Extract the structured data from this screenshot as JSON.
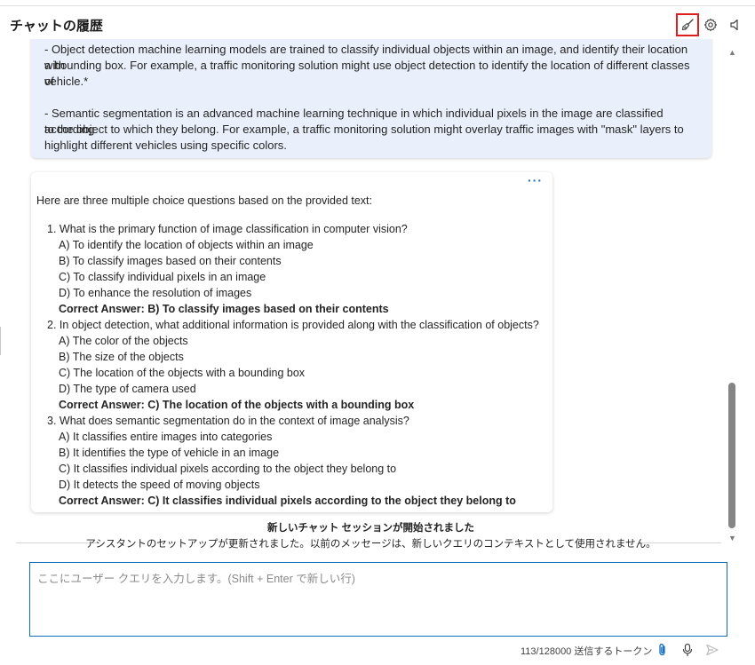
{
  "header": {
    "title": "チャットの履歴",
    "icons": [
      "broom-clear-icon",
      "gear-icon",
      "speaker-icon"
    ]
  },
  "user_message": {
    "lines": [
      "- Object detection machine learning models are trained to classify individual objects within an image, and identify their location with",
      "a bounding box. For example, a traffic monitoring solution might use object detection to identify the location of different classes of",
      "vehicle.*",
      "- Semantic segmentation is an advanced machine learning technique in which individual pixels in the image are classified according",
      "to the object to which they belong. For example, a traffic monitoring solution might overlay traffic images with \"mask\" layers to",
      "highlight different vehicles using specific colors."
    ]
  },
  "assistant_message": {
    "more_label": "···",
    "intro": "Here are three multiple choice questions based on the provided text:",
    "questions": [
      {
        "question": "1. What is the primary function of image classification in computer vision?",
        "options": [
          "A) To identify the location of objects within an image",
          "B) To classify images based on their contents",
          "C) To classify individual pixels in an image",
          "D) To enhance the resolution of images"
        ],
        "answer": "Correct Answer: B) To classify images based on their contents"
      },
      {
        "question": "2. In object detection, what additional information is provided along with the classification of objects?",
        "options": [
          "A) The color of the objects",
          "B) The size of the objects",
          "C) The location of the objects with a bounding box",
          "D) The type of camera used"
        ],
        "answer": "Correct Answer: C) The location of the objects with a bounding box"
      },
      {
        "question": "3. What does semantic segmentation do in the context of image analysis?",
        "options": [
          "A) It classifies entire images into categories",
          "B) It identifies the type of vehicle in an image",
          "C) It classifies individual pixels according to the object they belong to",
          "D) It detects the speed of moving objects"
        ],
        "answer": "Correct Answer: C) It classifies individual pixels according to the object they belong to"
      }
    ]
  },
  "session_notice": {
    "title": "新しいチャット セッションが開始されました",
    "subtitle": "アシスタントのセットアップが更新されました。以前のメッセージは、新しいクエリのコンテキストとして使用されません。"
  },
  "input": {
    "placeholder": "ここにユーザー クエリを入力します。(Shift + Enter で新しい行)",
    "value": ""
  },
  "footer": {
    "token_counter": "113/128000 送信するトークン",
    "icons": [
      "paperclip-icon",
      "microphone-icon",
      "send-icon"
    ]
  },
  "colors": {
    "accent": "#0f6cbd",
    "highlight_box": "#e01c1c",
    "user_bubble_bg": "#e9f0fb"
  }
}
